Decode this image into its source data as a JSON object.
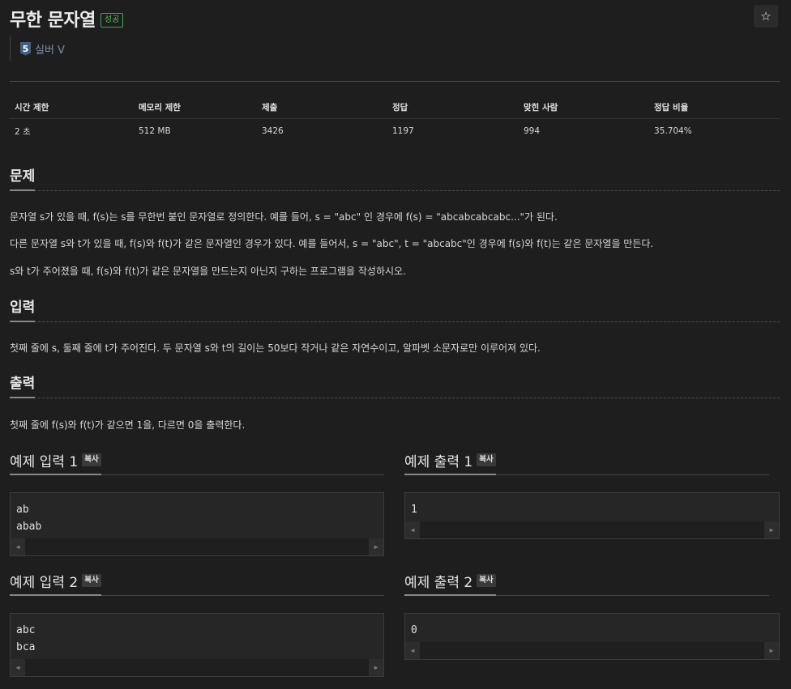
{
  "header": {
    "title": "무한 문자열",
    "status_badge": "성공",
    "star": "☆",
    "tier_level": "5",
    "tier_label": "실버 V"
  },
  "stats": {
    "headers": [
      "시간 제한",
      "메모리 제한",
      "제출",
      "정답",
      "맞힌 사람",
      "정답 비율"
    ],
    "values": [
      "2 초",
      "512 MB",
      "3426",
      "1197",
      "994",
      "35.704%"
    ]
  },
  "problem": {
    "title": "문제",
    "paragraphs": [
      "문자열 s가 있을 때, f(s)는 s를 무한번 붙인 문자열로 정의한다. 예를 들어, s = \"abc\" 인 경우에 f(s) = \"abcabcabcabc...\"가 된다.",
      "다른 문자열 s와 t가 있을 때, f(s)와 f(t)가 같은 문자열인 경우가 있다. 예를 들어서, s = \"abc\", t = \"abcabc\"인 경우에 f(s)와 f(t)는 같은 문자열을 만든다.",
      "s와 t가 주어졌을 때, f(s)와 f(t)가 같은 문자열을 만드는지 아닌지 구하는 프로그램을 작성하시오."
    ]
  },
  "input": {
    "title": "입력",
    "text": "첫째 줄에 s, 둘째 줄에 t가 주어진다. 두 문자열 s와 t의 길이는 50보다 작거나 같은 자연수이고, 알파벳 소문자로만 이루어져 있다."
  },
  "output": {
    "title": "출력",
    "text": "첫째 줄에 f(s)와 f(t)가 같으면 1을, 다르면 0을 출력한다."
  },
  "copy_label": "복사",
  "samples": [
    {
      "input_title": "예제 입력 1",
      "input_lines": [
        "ab",
        "abab"
      ],
      "output_title": "예제 출력 1",
      "output_lines": [
        "1"
      ]
    },
    {
      "input_title": "예제 입력 2",
      "input_lines": [
        "abc",
        "bca"
      ],
      "output_title": "예제 출력 2",
      "output_lines": [
        "0"
      ]
    }
  ]
}
